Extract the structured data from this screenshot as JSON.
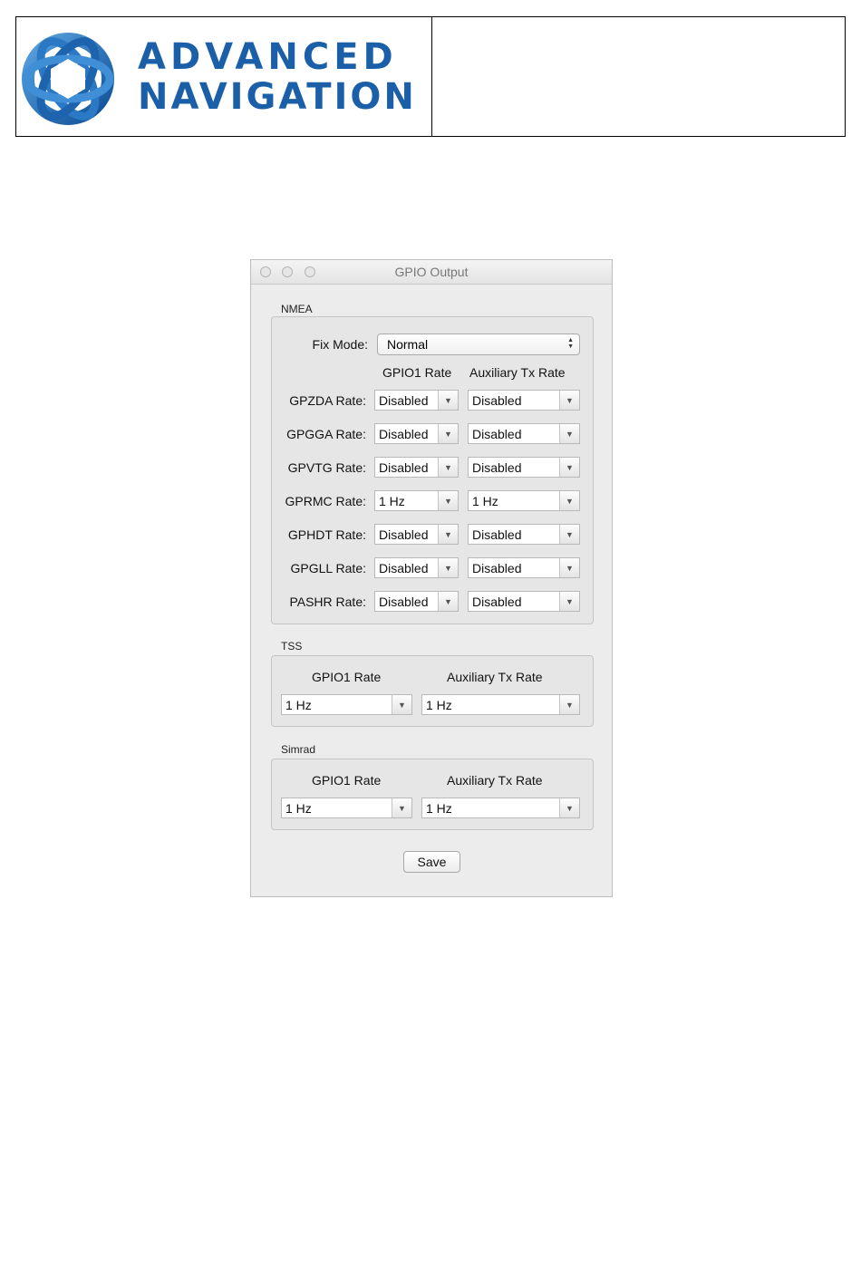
{
  "brand": {
    "line1": "ADVANCED",
    "line2": "NAVIGATION",
    "color": "#1a5fa8"
  },
  "window": {
    "title": "GPIO Output"
  },
  "nmea": {
    "group_label": "NMEA",
    "fix_mode_label": "Fix Mode:",
    "fix_mode_value": "Normal",
    "col_gpio1": "GPIO1 Rate",
    "col_aux": "Auxiliary Tx Rate",
    "rows": [
      {
        "label": "GPZDA Rate:",
        "gpio1": "Disabled",
        "aux": "Disabled"
      },
      {
        "label": "GPGGA Rate:",
        "gpio1": "Disabled",
        "aux": "Disabled"
      },
      {
        "label": "GPVTG Rate:",
        "gpio1": "Disabled",
        "aux": "Disabled"
      },
      {
        "label": "GPRMC Rate:",
        "gpio1": "1 Hz",
        "aux": "1 Hz"
      },
      {
        "label": "GPHDT Rate:",
        "gpio1": "Disabled",
        "aux": "Disabled"
      },
      {
        "label": "GPGLL Rate:",
        "gpio1": "Disabled",
        "aux": "Disabled"
      },
      {
        "label": "PASHR Rate:",
        "gpio1": "Disabled",
        "aux": "Disabled"
      }
    ]
  },
  "tss": {
    "group_label": "TSS",
    "col_gpio1": "GPIO1 Rate",
    "col_aux": "Auxiliary Tx Rate",
    "gpio1": "1 Hz",
    "aux": "1 Hz"
  },
  "simrad": {
    "group_label": "Simrad",
    "col_gpio1": "GPIO1 Rate",
    "col_aux": "Auxiliary Tx Rate",
    "gpio1": "1 Hz",
    "aux": "1 Hz"
  },
  "save_label": "Save"
}
